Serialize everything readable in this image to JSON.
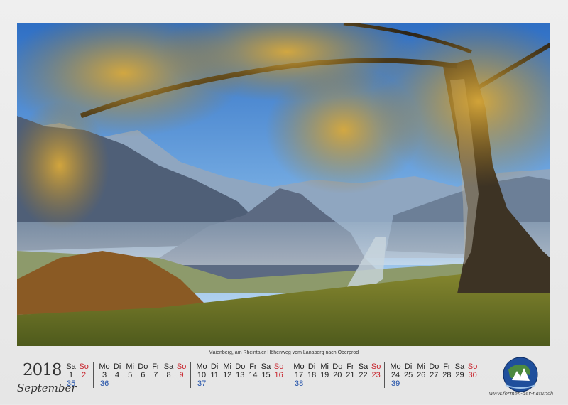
{
  "caption": "Maienberg, am Rheintaler Höhenweg vom Lanaberg nach Oberprod",
  "year": "2018",
  "month": "September",
  "weeks": [
    {
      "days": [
        [
          "Sa",
          "1",
          false
        ],
        [
          "So",
          "2",
          true
        ]
      ],
      "wn": "35"
    },
    {
      "days": [
        [
          "Mo",
          "3",
          false
        ],
        [
          "Di",
          "4",
          false
        ],
        [
          "Mi",
          "5",
          false
        ],
        [
          "Do",
          "6",
          false
        ],
        [
          "Fr",
          "7",
          false
        ],
        [
          "Sa",
          "8",
          false
        ],
        [
          "So",
          "9",
          true
        ]
      ],
      "wn": "36"
    },
    {
      "days": [
        [
          "Mo",
          "10",
          false
        ],
        [
          "Di",
          "11",
          false
        ],
        [
          "Mi",
          "12",
          false
        ],
        [
          "Do",
          "13",
          false
        ],
        [
          "Fr",
          "14",
          false
        ],
        [
          "Sa",
          "15",
          false
        ],
        [
          "So",
          "16",
          true
        ]
      ],
      "wn": "37"
    },
    {
      "days": [
        [
          "Mo",
          "17",
          false
        ],
        [
          "Di",
          "18",
          false
        ],
        [
          "Mi",
          "19",
          false
        ],
        [
          "Do",
          "20",
          false
        ],
        [
          "Fr",
          "21",
          false
        ],
        [
          "Sa",
          "22",
          false
        ],
        [
          "So",
          "23",
          true
        ]
      ],
      "wn": "38"
    },
    {
      "days": [
        [
          "Mo",
          "24",
          false
        ],
        [
          "Di",
          "25",
          false
        ],
        [
          "Mi",
          "26",
          false
        ],
        [
          "Do",
          "27",
          false
        ],
        [
          "Fr",
          "28",
          false
        ],
        [
          "Sa",
          "29",
          false
        ],
        [
          "So",
          "30",
          true
        ]
      ],
      "wn": "39"
    }
  ],
  "logo_url": "www.formen-der-natur.ch",
  "colors": {
    "sunday": "#c8232c",
    "week_number": "#1f4fa8"
  }
}
